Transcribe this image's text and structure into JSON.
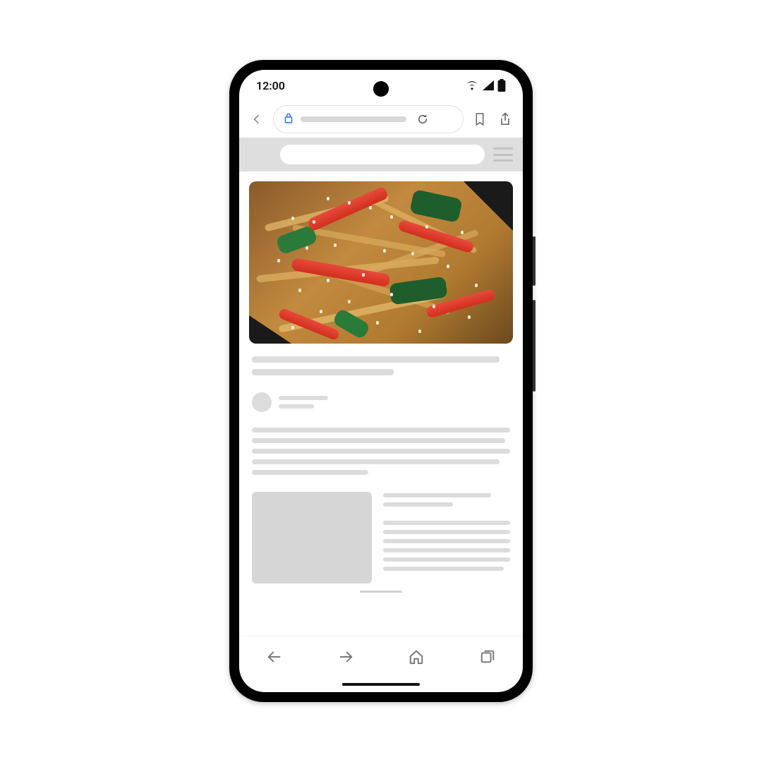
{
  "status": {
    "time": "12:00",
    "wifi_icon": "wifi-icon",
    "signal_icon": "cell-signal-icon",
    "battery_icon": "battery-icon"
  },
  "toolbar": {
    "back_icon": "chevron-left-icon",
    "lock_icon": "lock-icon",
    "url_placeholder": "",
    "reload_icon": "reload-icon",
    "bookmark_icon": "bookmark-icon",
    "share_icon": "share-icon"
  },
  "page": {
    "site_menu_icon": "hamburger-icon",
    "hero_alt": "stir-fried glass noodles with red peppers, greens and sesame"
  },
  "bottom_nav": {
    "back_icon": "arrow-left-icon",
    "forward_icon": "arrow-right-icon",
    "home_icon": "home-icon",
    "tabs_icon": "tabs-icon"
  }
}
